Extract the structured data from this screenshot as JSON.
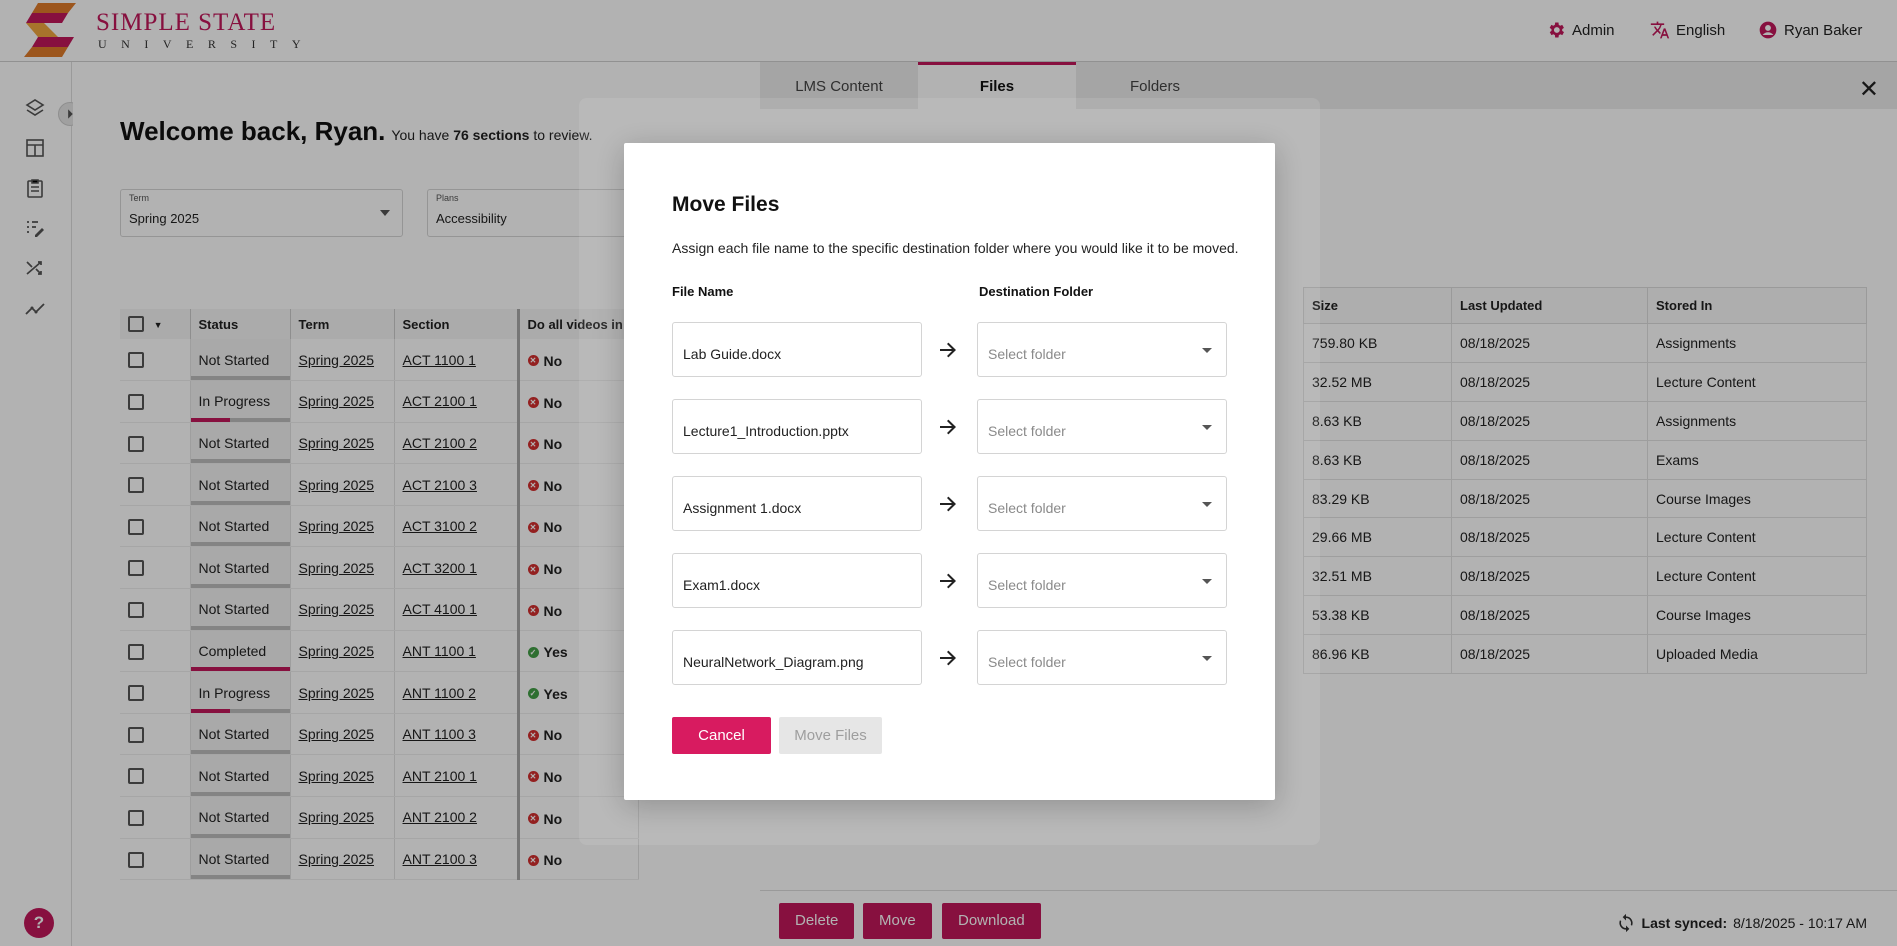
{
  "brand": {
    "name": "SIMPLE STATE",
    "sub": "UNIVERSITY",
    "accent": "#c2185b"
  },
  "header": {
    "admin": "Admin",
    "language": "English",
    "user": "Ryan Baker"
  },
  "welcome": {
    "title": "Welcome back, Ryan.",
    "pre": "You have",
    "count": "76 sections",
    "post": "to review."
  },
  "filters": {
    "term": {
      "label": "Term",
      "value": "Spring 2025"
    },
    "plans": {
      "label": "Plans",
      "value": "Accessibility"
    }
  },
  "sections_table": {
    "headers": [
      "Status",
      "Term",
      "Section",
      "Do all videos in"
    ],
    "rows": [
      {
        "status": "Not Started",
        "progress": 0,
        "term": "Spring 2025",
        "section": "ACT 1100 1",
        "videos": "No"
      },
      {
        "status": "In Progress",
        "progress": 0.4,
        "term": "Spring 2025",
        "section": "ACT 2100 1",
        "videos": "No"
      },
      {
        "status": "Not Started",
        "progress": 0,
        "term": "Spring 2025",
        "section": "ACT 2100 2",
        "videos": "No"
      },
      {
        "status": "Not Started",
        "progress": 0,
        "term": "Spring 2025",
        "section": "ACT 2100 3",
        "videos": "No"
      },
      {
        "status": "Not Started",
        "progress": 0,
        "term": "Spring 2025",
        "section": "ACT 3100 2",
        "videos": "No"
      },
      {
        "status": "Not Started",
        "progress": 0,
        "term": "Spring 2025",
        "section": "ACT 3200 1",
        "videos": "No"
      },
      {
        "status": "Not Started",
        "progress": 0,
        "term": "Spring 2025",
        "section": "ACT 4100 1",
        "videos": "No"
      },
      {
        "status": "Completed",
        "progress": 1,
        "term": "Spring 2025",
        "section": "ANT 1100 1",
        "videos": "Yes"
      },
      {
        "status": "In Progress",
        "progress": 0.4,
        "term": "Spring 2025",
        "section": "ANT 1100 2",
        "videos": "Yes"
      },
      {
        "status": "Not Started",
        "progress": 0,
        "term": "Spring 2025",
        "section": "ANT 1100 3",
        "videos": "No"
      },
      {
        "status": "Not Started",
        "progress": 0,
        "term": "Spring 2025",
        "section": "ANT 2100 1",
        "videos": "No"
      },
      {
        "status": "Not Started",
        "progress": 0,
        "term": "Spring 2025",
        "section": "ANT 2100 2",
        "videos": "No"
      },
      {
        "status": "Not Started",
        "progress": 0,
        "term": "Spring 2025",
        "section": "ANT 2100 3",
        "videos": "No"
      }
    ]
  },
  "panel": {
    "tabs": [
      "LMS Content",
      "Files",
      "Folders"
    ],
    "active_tab": "Files",
    "files_table": {
      "headers": [
        "Size",
        "Last Updated",
        "Stored In"
      ],
      "rows": [
        [
          "759.80 KB",
          "08/18/2025",
          "Assignments"
        ],
        [
          "32.52 MB",
          "08/18/2025",
          "Lecture Content"
        ],
        [
          "8.63 KB",
          "08/18/2025",
          "Assignments"
        ],
        [
          "8.63 KB",
          "08/18/2025",
          "Exams"
        ],
        [
          "83.29 KB",
          "08/18/2025",
          "Course Images"
        ],
        [
          "29.66 MB",
          "08/18/2025",
          "Lecture Content"
        ],
        [
          "32.51 MB",
          "08/18/2025",
          "Lecture Content"
        ],
        [
          "53.38 KB",
          "08/18/2025",
          "Course Images"
        ],
        [
          "86.96 KB",
          "08/18/2025",
          "Uploaded Media"
        ]
      ]
    },
    "footer": {
      "delete": "Delete",
      "move": "Move",
      "download": "Download",
      "sync_label": "Last synced:",
      "sync_value": "8/18/2025 - 10:17 AM"
    }
  },
  "modal": {
    "title": "Move Files",
    "description": "Assign each file name to the specific destination folder where you would like it to be moved.",
    "col_file": "File Name",
    "col_dest": "Destination Folder",
    "placeholder": "Select folder",
    "files": [
      "Lab Guide.docx",
      "Lecture1_Introduction.pptx",
      "Assignment 1.docx",
      "Exam1.docx",
      "NeuralNetwork_Diagram.png"
    ],
    "cancel": "Cancel",
    "confirm": "Move Files"
  },
  "help": "?"
}
